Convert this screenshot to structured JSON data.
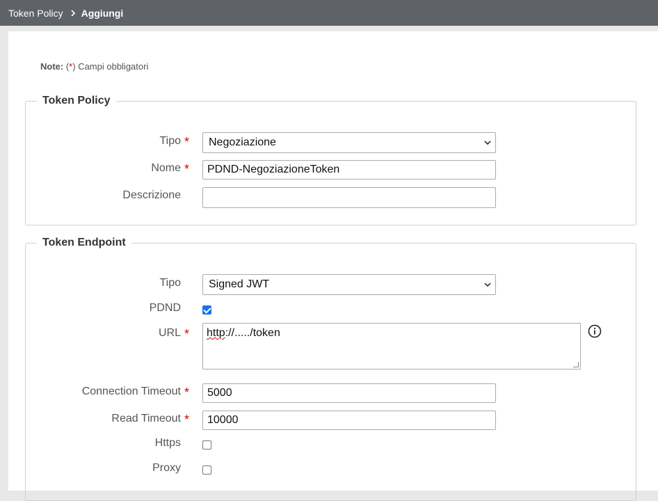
{
  "breadcrumb": {
    "parent": "Token Policy",
    "current": "Aggiungi"
  },
  "note": {
    "label": "Note:",
    "text_before": " (",
    "star": "*",
    "text_after": ") Campi obbligatori"
  },
  "token_policy": {
    "legend": "Token Policy",
    "tipo": {
      "label": "Tipo",
      "value": "Negoziazione"
    },
    "nome": {
      "label": "Nome",
      "value": "PDND-NegoziazioneToken"
    },
    "descrizione": {
      "label": "Descrizione",
      "value": ""
    }
  },
  "token_endpoint": {
    "legend": "Token Endpoint",
    "tipo": {
      "label": "Tipo",
      "value": "Signed JWT"
    },
    "pdnd": {
      "label": "PDND",
      "checked": true
    },
    "url": {
      "label": "URL",
      "value_underlined": "http",
      "value_rest": "://...../token"
    },
    "connection_timeout": {
      "label": "Connection Timeout",
      "value": "5000"
    },
    "read_timeout": {
      "label": "Read Timeout",
      "value": "10000"
    },
    "https": {
      "label": "Https",
      "checked": false
    },
    "proxy": {
      "label": "Proxy",
      "checked": false
    }
  },
  "required_marker": "*",
  "colors": {
    "topbar": "#5f6367",
    "required": "#dd0000",
    "checkbox_accent": "#1a73e8"
  }
}
